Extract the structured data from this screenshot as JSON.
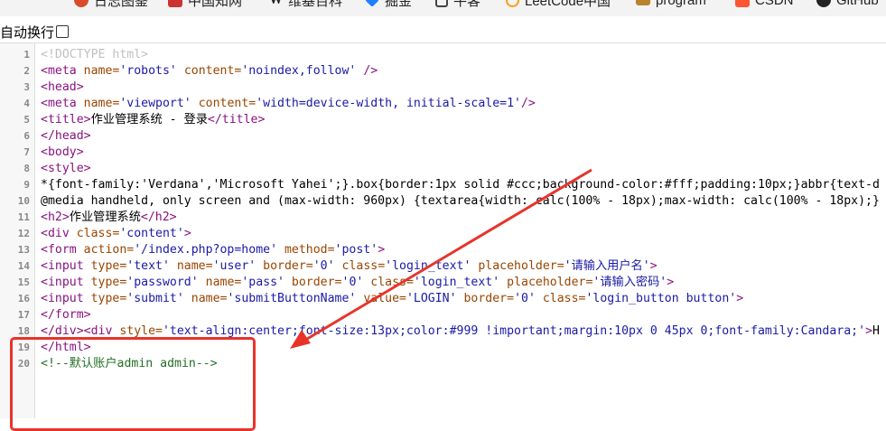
{
  "bookmarks": [
    {
      "label": "日志图鉴",
      "icon": "red-badge-icon",
      "color": "#d94b2b"
    },
    {
      "label": "中国知网",
      "icon": "red-square-icon",
      "color": "#c33"
    },
    {
      "label": "维基百科",
      "icon": "wikipedia-w-icon",
      "color": "#333"
    },
    {
      "label": "掘金",
      "icon": "juejin-icon",
      "color": "#1e80ff"
    },
    {
      "label": "牛客",
      "icon": "bookmark-icon",
      "color": "#333"
    },
    {
      "label": "LeetCode中国",
      "icon": "leetcode-icon",
      "color": "#f89f1b"
    },
    {
      "label": "program",
      "icon": "folder-icon",
      "color": "#b9832e"
    },
    {
      "label": "CSDN",
      "icon": "csdn-icon",
      "color": "#fc5531"
    },
    {
      "label": "GitHub",
      "icon": "github-icon",
      "color": "#222"
    }
  ],
  "toolbar": {
    "wrap_label": "自动换行"
  },
  "lines": [
    {
      "n": "1",
      "parts": [
        {
          "c": "doc",
          "t": "<!DOCTYPE html>"
        }
      ]
    },
    {
      "n": "2",
      "parts": [
        {
          "c": "tag",
          "t": "<meta "
        },
        {
          "c": "an",
          "t": "name="
        },
        {
          "c": "av",
          "t": "'robots'"
        },
        {
          "c": "an",
          "t": " content="
        },
        {
          "c": "av",
          "t": "'noindex,follow'"
        },
        {
          "c": "tag",
          "t": " />"
        }
      ]
    },
    {
      "n": "3",
      "parts": [
        {
          "c": "tag",
          "t": "<head>"
        }
      ]
    },
    {
      "n": "4",
      "parts": [
        {
          "c": "tag",
          "t": "<meta "
        },
        {
          "c": "an",
          "t": "name="
        },
        {
          "c": "av",
          "t": "'viewport'"
        },
        {
          "c": "an",
          "t": " content="
        },
        {
          "c": "av",
          "t": "'width=device-width, initial-scale=1'"
        },
        {
          "c": "tag",
          "t": "/>"
        }
      ]
    },
    {
      "n": "5",
      "parts": [
        {
          "c": "tag",
          "t": "<title>"
        },
        {
          "c": "txt",
          "t": "作业管理系统 - 登录"
        },
        {
          "c": "tag",
          "t": "</title>"
        }
      ]
    },
    {
      "n": "6",
      "parts": [
        {
          "c": "tag",
          "t": "</head>"
        }
      ]
    },
    {
      "n": "7",
      "parts": [
        {
          "c": "tag",
          "t": "<body>"
        }
      ]
    },
    {
      "n": "8",
      "parts": [
        {
          "c": "tag",
          "t": "<style>"
        }
      ]
    },
    {
      "n": "9",
      "parts": [
        {
          "c": "txt",
          "t": "*{font-family:'Verdana','Microsoft Yahei';}.box{border:1px solid #ccc;background-color:#fff;padding:10px;}abbr{text-d"
        }
      ]
    },
    {
      "n": "10",
      "parts": [
        {
          "c": "txt",
          "t": "@media handheld, only screen and (max-width: 960px) {textarea{width: calc(100% - 18px);max-width: calc(100% - 18px);}"
        }
      ]
    },
    {
      "n": "11",
      "parts": [
        {
          "c": "tag",
          "t": "<h2>"
        },
        {
          "c": "txt",
          "t": "作业管理系统"
        },
        {
          "c": "tag",
          "t": "</h2>"
        }
      ]
    },
    {
      "n": "12",
      "parts": [
        {
          "c": "tag",
          "t": "<div "
        },
        {
          "c": "an",
          "t": "class="
        },
        {
          "c": "av",
          "t": "'content'"
        },
        {
          "c": "tag",
          "t": ">"
        }
      ]
    },
    {
      "n": "13",
      "parts": [
        {
          "c": "tag",
          "t": "<form "
        },
        {
          "c": "an",
          "t": "action="
        },
        {
          "c": "av",
          "t": "'/index.php?op=home'"
        },
        {
          "c": "an",
          "t": " method="
        },
        {
          "c": "av",
          "t": "'post'"
        },
        {
          "c": "tag",
          "t": ">"
        }
      ]
    },
    {
      "n": "14",
      "parts": [
        {
          "c": "tag",
          "t": "<input "
        },
        {
          "c": "an",
          "t": "type="
        },
        {
          "c": "av",
          "t": "'text'"
        },
        {
          "c": "an",
          "t": " name="
        },
        {
          "c": "av",
          "t": "'user'"
        },
        {
          "c": "an",
          "t": " border="
        },
        {
          "c": "av",
          "t": "'0'"
        },
        {
          "c": "an",
          "t": " class="
        },
        {
          "c": "av",
          "t": "'login_text'"
        },
        {
          "c": "an",
          "t": " placeholder="
        },
        {
          "c": "av",
          "t": "'请输入用户名'"
        },
        {
          "c": "tag",
          "t": ">"
        }
      ]
    },
    {
      "n": "15",
      "parts": [
        {
          "c": "tag",
          "t": "<input "
        },
        {
          "c": "an",
          "t": "type="
        },
        {
          "c": "av",
          "t": "'password'"
        },
        {
          "c": "an",
          "t": " name="
        },
        {
          "c": "av",
          "t": "'pass'"
        },
        {
          "c": "an",
          "t": " border="
        },
        {
          "c": "av",
          "t": "'0'"
        },
        {
          "c": "an",
          "t": " class="
        },
        {
          "c": "av",
          "t": "'login_text'"
        },
        {
          "c": "an",
          "t": " placeholder="
        },
        {
          "c": "av",
          "t": "'请输入密码'"
        },
        {
          "c": "tag",
          "t": ">"
        }
      ]
    },
    {
      "n": "16",
      "parts": [
        {
          "c": "tag",
          "t": "<input "
        },
        {
          "c": "an",
          "t": "type="
        },
        {
          "c": "av",
          "t": "'submit'"
        },
        {
          "c": "an",
          "t": " name="
        },
        {
          "c": "av",
          "t": "'submitButtonName'"
        },
        {
          "c": "an",
          "t": " value="
        },
        {
          "c": "av",
          "t": "'LOGIN'"
        },
        {
          "c": "an",
          "t": " border="
        },
        {
          "c": "av",
          "t": "'0'"
        },
        {
          "c": "an",
          "t": " class="
        },
        {
          "c": "av",
          "t": "'login_button button'"
        },
        {
          "c": "tag",
          "t": ">"
        }
      ]
    },
    {
      "n": "17",
      "parts": [
        {
          "c": "tag",
          "t": "</form>"
        }
      ]
    },
    {
      "n": "18",
      "parts": [
        {
          "c": "tag",
          "t": "</div><div "
        },
        {
          "c": "an",
          "t": "style="
        },
        {
          "c": "av",
          "t": "'text-align:center;font-size:13px;color:#999 !important;margin:10px 0 45px 0;font-family:Candara;'"
        },
        {
          "c": "tag",
          "t": ">"
        },
        {
          "c": "txt",
          "t": "H"
        }
      ]
    },
    {
      "n": "19",
      "parts": [
        {
          "c": "tag",
          "t": "</html>"
        }
      ]
    },
    {
      "n": "20",
      "parts": [
        {
          "c": "cm",
          "t": "<!--默认账户admin admin-->"
        }
      ]
    }
  ],
  "annotation": {
    "color": "#e8332b"
  }
}
